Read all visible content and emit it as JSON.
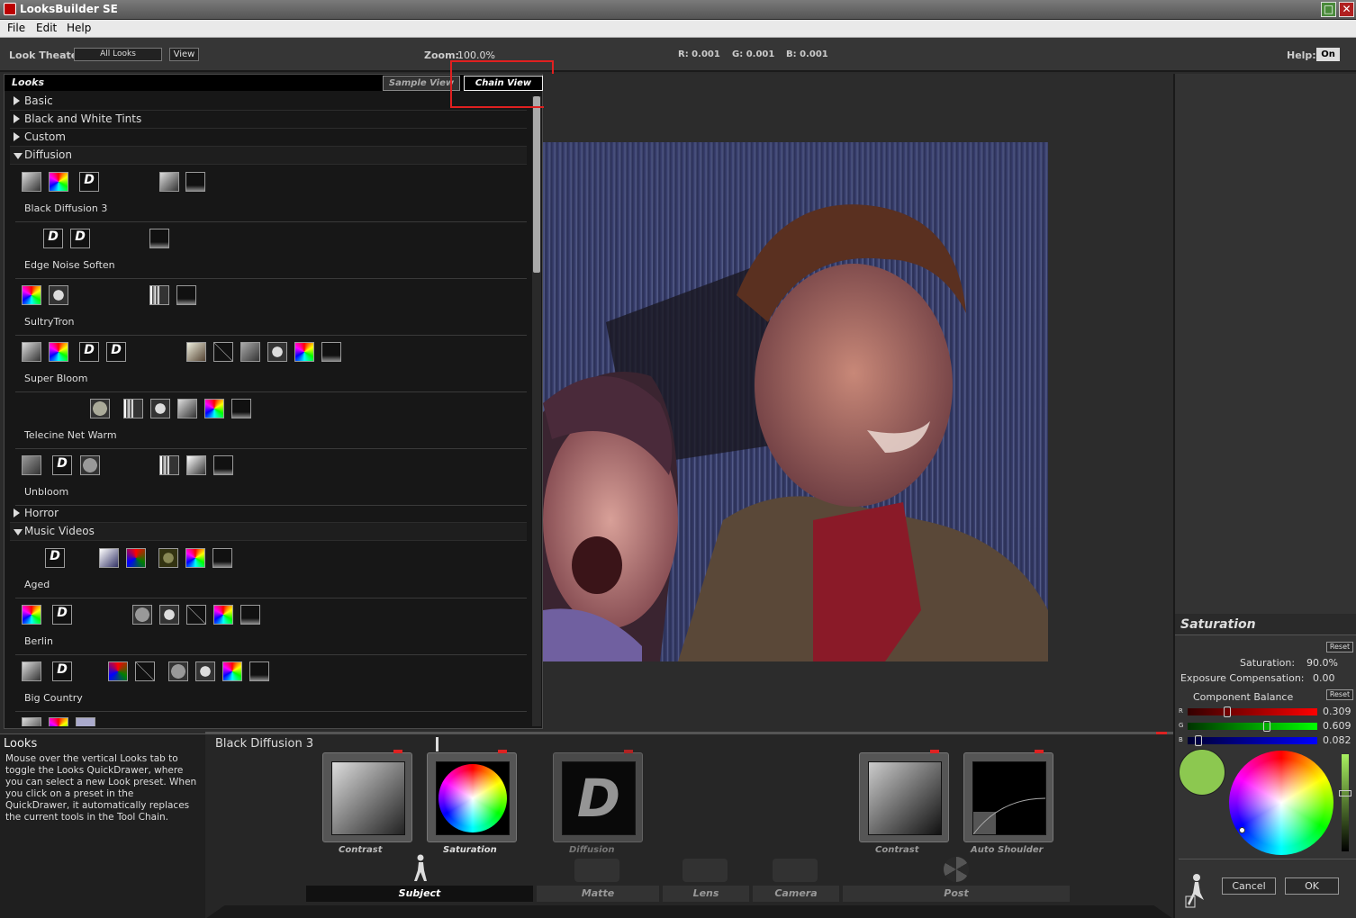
{
  "window": {
    "title": "LooksBuilder SE"
  },
  "menu": {
    "file": "File",
    "edit": "Edit",
    "help": "Help"
  },
  "toolbar": {
    "look_theater_label": "Look Theater:",
    "look_theater_value": "All Looks",
    "view_button": "View",
    "zoom_label": "Zoom:",
    "zoom_value": "100.0%",
    "r": "R: 0.001",
    "g": "G: 0.001",
    "b": "B: 0.001",
    "help_label": "Help:",
    "help_value": "On"
  },
  "looks_panel": {
    "title": "Looks",
    "tabs": [
      "Sample View",
      "Chain View"
    ],
    "active_tab": "Chain View",
    "categories": [
      {
        "name": "Basic",
        "open": false
      },
      {
        "name": "Black and White Tints",
        "open": false
      },
      {
        "name": "Custom",
        "open": false
      },
      {
        "name": "Diffusion",
        "open": true,
        "looks": [
          "Black Diffusion 3",
          "Edge Noise Soften",
          "SultryTron",
          "Super Bloom",
          "Telecine Net Warm",
          "Unbloom"
        ]
      },
      {
        "name": "Horror",
        "open": false
      },
      {
        "name": "Music Videos",
        "open": true,
        "looks": [
          "Aged",
          "Berlin",
          "Big Country"
        ]
      }
    ]
  },
  "info": {
    "title": "Looks",
    "text": "Mouse over the vertical Looks tab to toggle the Looks QuickDrawer, where you can select a new Look preset. When you click on a preset in the QuickDrawer, it automatically replaces the current tools in the Tool Chain."
  },
  "chain": {
    "current_look": "Black Diffusion 3",
    "tools": [
      "Contrast",
      "Saturation",
      "Diffusion",
      "Contrast",
      "Auto Shoulder"
    ],
    "categories": [
      "Subject",
      "Matte",
      "Lens",
      "Camera",
      "Post"
    ],
    "active_category": "Subject"
  },
  "saturation_panel": {
    "title": "Saturation",
    "reset": "Reset",
    "saturation_label": "Saturation:",
    "saturation_value": "90.0%",
    "exposure_label": "Exposure Compensation:",
    "exposure_value": "0.00",
    "component_label": "Component Balance",
    "reset2": "Reset",
    "r_label": "R",
    "r_value": "0.309",
    "g_label": "G",
    "g_value": "0.609",
    "b_label": "B",
    "b_value": "0.082",
    "r_level": 0.309,
    "g_level": 0.609,
    "b_level": 0.082,
    "swatch_color": "#8cc850",
    "cancel": "Cancel",
    "ok": "OK"
  }
}
